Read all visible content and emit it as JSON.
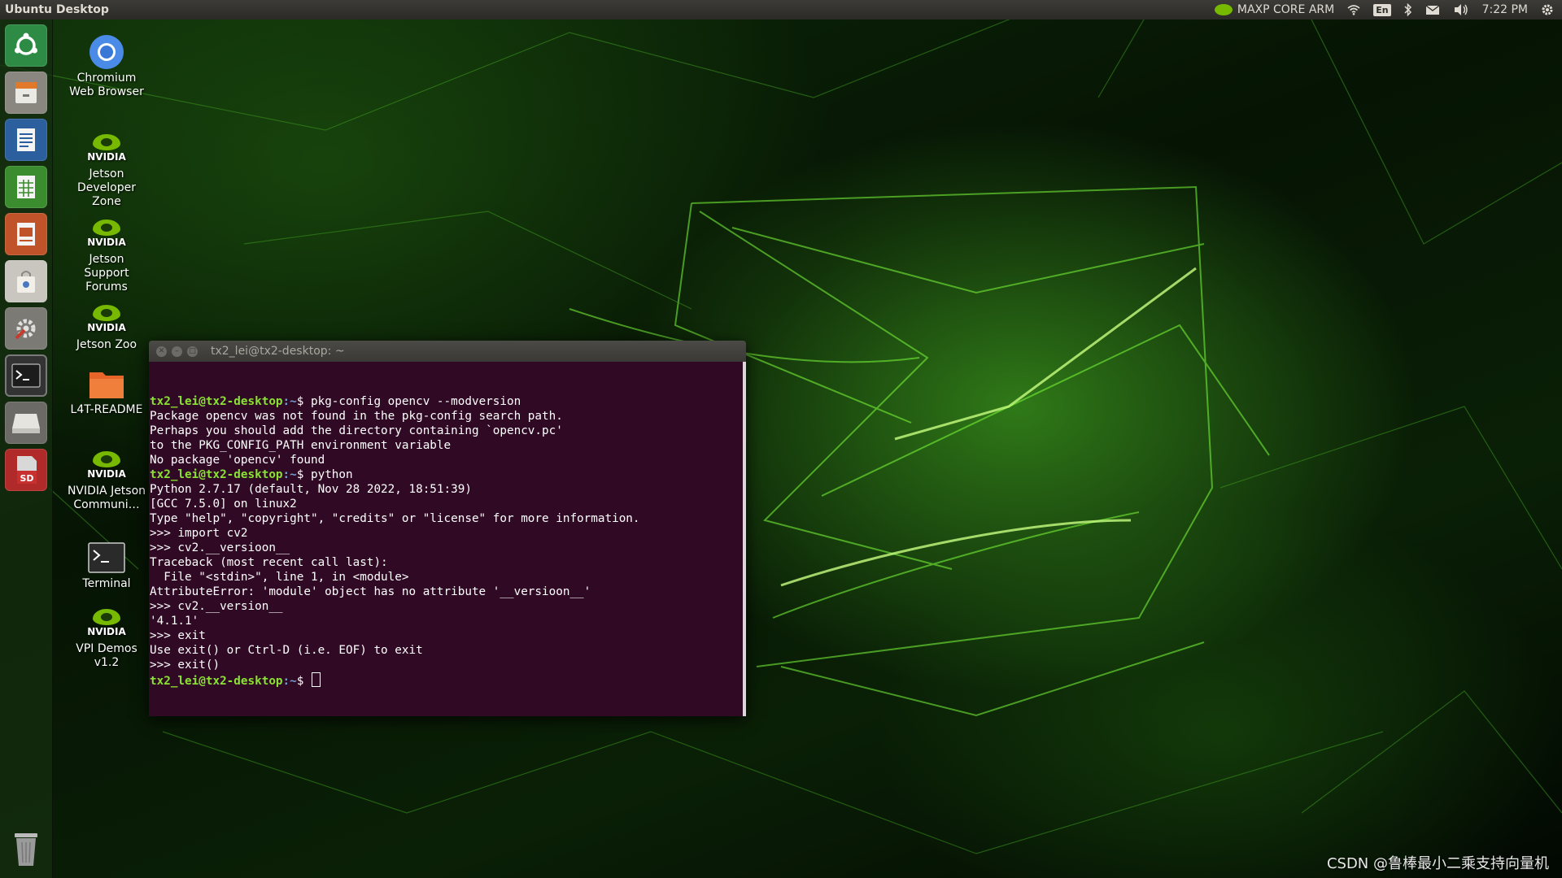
{
  "panel": {
    "title": "Ubuntu Desktop",
    "nvpmodel": "MAXP CORE ARM",
    "lang": "En",
    "clock": "7:22 PM"
  },
  "launcher": {
    "items": [
      {
        "name": "ubuntu-dash",
        "icon": "ubuntu-logo-icon",
        "color": "#2e8b45"
      },
      {
        "name": "files",
        "icon": "file-cabinet-icon",
        "color": "#8a8780"
      },
      {
        "name": "writer",
        "icon": "document-icon",
        "color": "#2c5f9e"
      },
      {
        "name": "calc",
        "icon": "spreadsheet-icon",
        "color": "#3b8c2e"
      },
      {
        "name": "impress",
        "icon": "presentation-icon",
        "color": "#c0532a"
      },
      {
        "name": "software",
        "icon": "shopping-bag-icon",
        "color": "#c9c6c0"
      },
      {
        "name": "settings",
        "icon": "gear-wrench-icon",
        "color": "#7b7a75"
      },
      {
        "name": "terminal",
        "icon": "terminal-icon",
        "color": "#333"
      },
      {
        "name": "drive",
        "icon": "disk-drive-icon",
        "color": "#d2d0cb"
      },
      {
        "name": "sd-card",
        "icon": "sd-card-icon",
        "color": "#b02a2a"
      },
      {
        "name": "trash",
        "icon": "trash-icon",
        "color": "#777"
      }
    ]
  },
  "desktop_icons": [
    {
      "label": "Chromium Web Browser",
      "icon": "chromium-icon"
    },
    {
      "label": "Jetson Developer Zone",
      "icon": "nvidia-icon"
    },
    {
      "label": "Jetson Support Forums",
      "icon": "nvidia-icon"
    },
    {
      "label": "Jetson Zoo",
      "icon": "nvidia-icon"
    },
    {
      "label": "L4T-README",
      "icon": "folder-icon"
    },
    {
      "label": "NVIDIA Jetson Communi…",
      "icon": "nvidia-icon"
    },
    {
      "label": "Terminal",
      "icon": "terminal-icon"
    },
    {
      "label": "VPI Demos v1.2",
      "icon": "nvidia-icon"
    }
  ],
  "nvidia_text": "NVIDIA",
  "terminal": {
    "title": "tx2_lei@tx2-desktop: ~",
    "prompt_user": "tx2_lei@tx2-desktop",
    "prompt_path": ":~",
    "prompt_symbol": "$ ",
    "lines": [
      {
        "type": "prompt",
        "text": "pkg-config opencv --modversion"
      },
      {
        "type": "out",
        "text": "Package opencv was not found in the pkg-config search path."
      },
      {
        "type": "out",
        "text": "Perhaps you should add the directory containing `opencv.pc'"
      },
      {
        "type": "out",
        "text": "to the PKG_CONFIG_PATH environment variable"
      },
      {
        "type": "out",
        "text": "No package 'opencv' found"
      },
      {
        "type": "prompt",
        "text": "python"
      },
      {
        "type": "out",
        "text": "Python 2.7.17 (default, Nov 28 2022, 18:51:39)"
      },
      {
        "type": "out",
        "text": "[GCC 7.5.0] on linux2"
      },
      {
        "type": "out",
        "text": "Type \"help\", \"copyright\", \"credits\" or \"license\" for more information."
      },
      {
        "type": "out",
        "text": ">>> import cv2"
      },
      {
        "type": "out",
        "text": ">>> cv2.__versioon__"
      },
      {
        "type": "out",
        "text": "Traceback (most recent call last):"
      },
      {
        "type": "out",
        "text": "  File \"<stdin>\", line 1, in <module>"
      },
      {
        "type": "out",
        "text": "AttributeError: 'module' object has no attribute '__versioon__'"
      },
      {
        "type": "out",
        "text": ">>> cv2.__version__"
      },
      {
        "type": "out",
        "text": "'4.1.1'"
      },
      {
        "type": "out",
        "text": ">>> exit"
      },
      {
        "type": "out",
        "text": "Use exit() or Ctrl-D (i.e. EOF) to exit"
      },
      {
        "type": "out",
        "text": ">>> exit()"
      },
      {
        "type": "prompt-cursor",
        "text": ""
      }
    ]
  },
  "watermark": "CSDN @鲁棒最小二乘支持向量机"
}
